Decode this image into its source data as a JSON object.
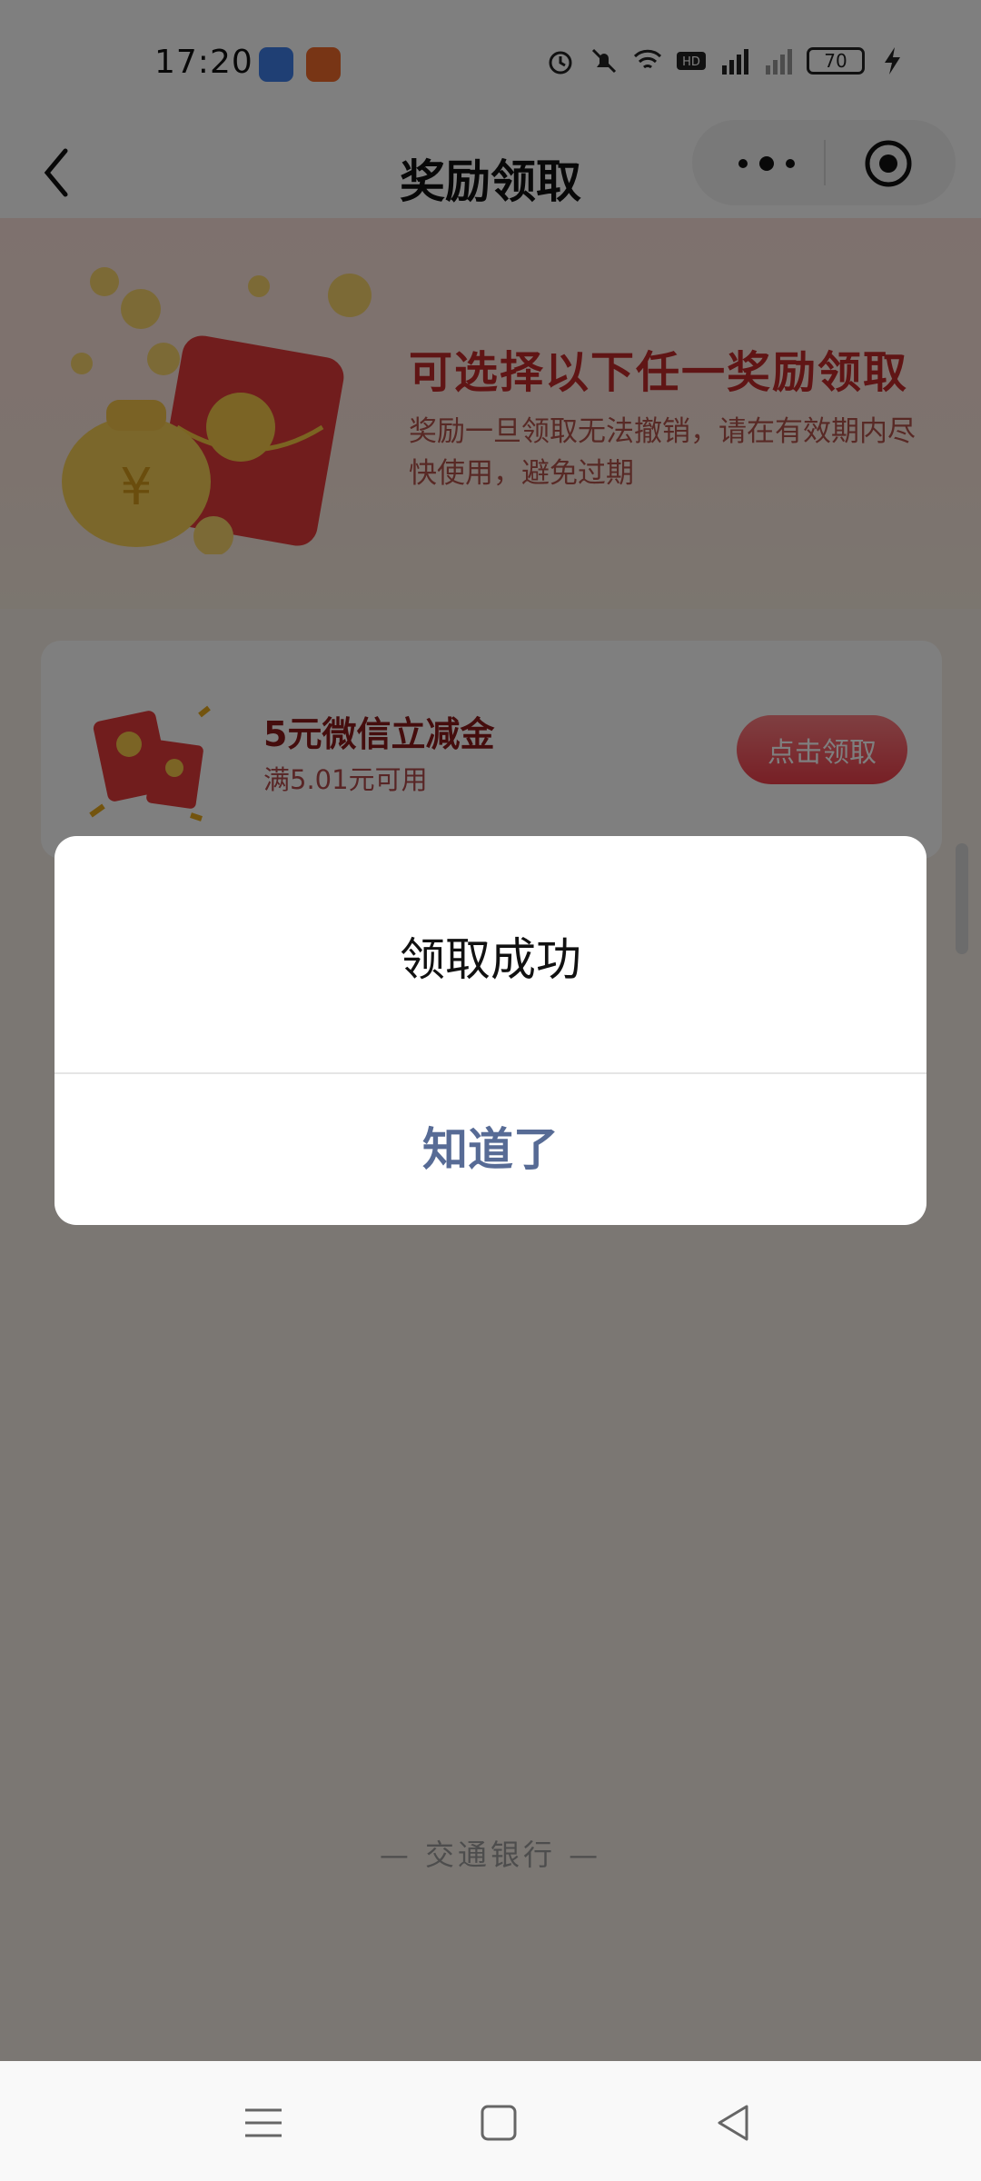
{
  "status_bar": {
    "time": "17:20",
    "battery": "70",
    "icons": [
      "alarm-icon",
      "mute-icon",
      "wifi-icon",
      "hd-icon",
      "signal-5g-icon",
      "signal-icon",
      "battery-icon",
      "charging-icon"
    ]
  },
  "navbar": {
    "title": "奖励领取",
    "back_icon": "chevron-left-icon",
    "more_icon": "more-dots-icon",
    "close_icon": "target-close-icon"
  },
  "hero": {
    "title": "可选择以下任一奖励领取",
    "subtitle": "奖励一旦领取无法撤销，请在有效期内尽快使用，避免过期"
  },
  "reward": {
    "name": "5元微信立减金",
    "condition": "满5.01元可用",
    "button_label": "点击领取"
  },
  "footer": {
    "brand": "— 交通银行 —"
  },
  "modal": {
    "title": "领取成功",
    "confirm_label": "知道了"
  },
  "colors": {
    "accent_red": "#c02a2a",
    "button_red": "#ef3f4b",
    "link_blue": "#576b95"
  }
}
